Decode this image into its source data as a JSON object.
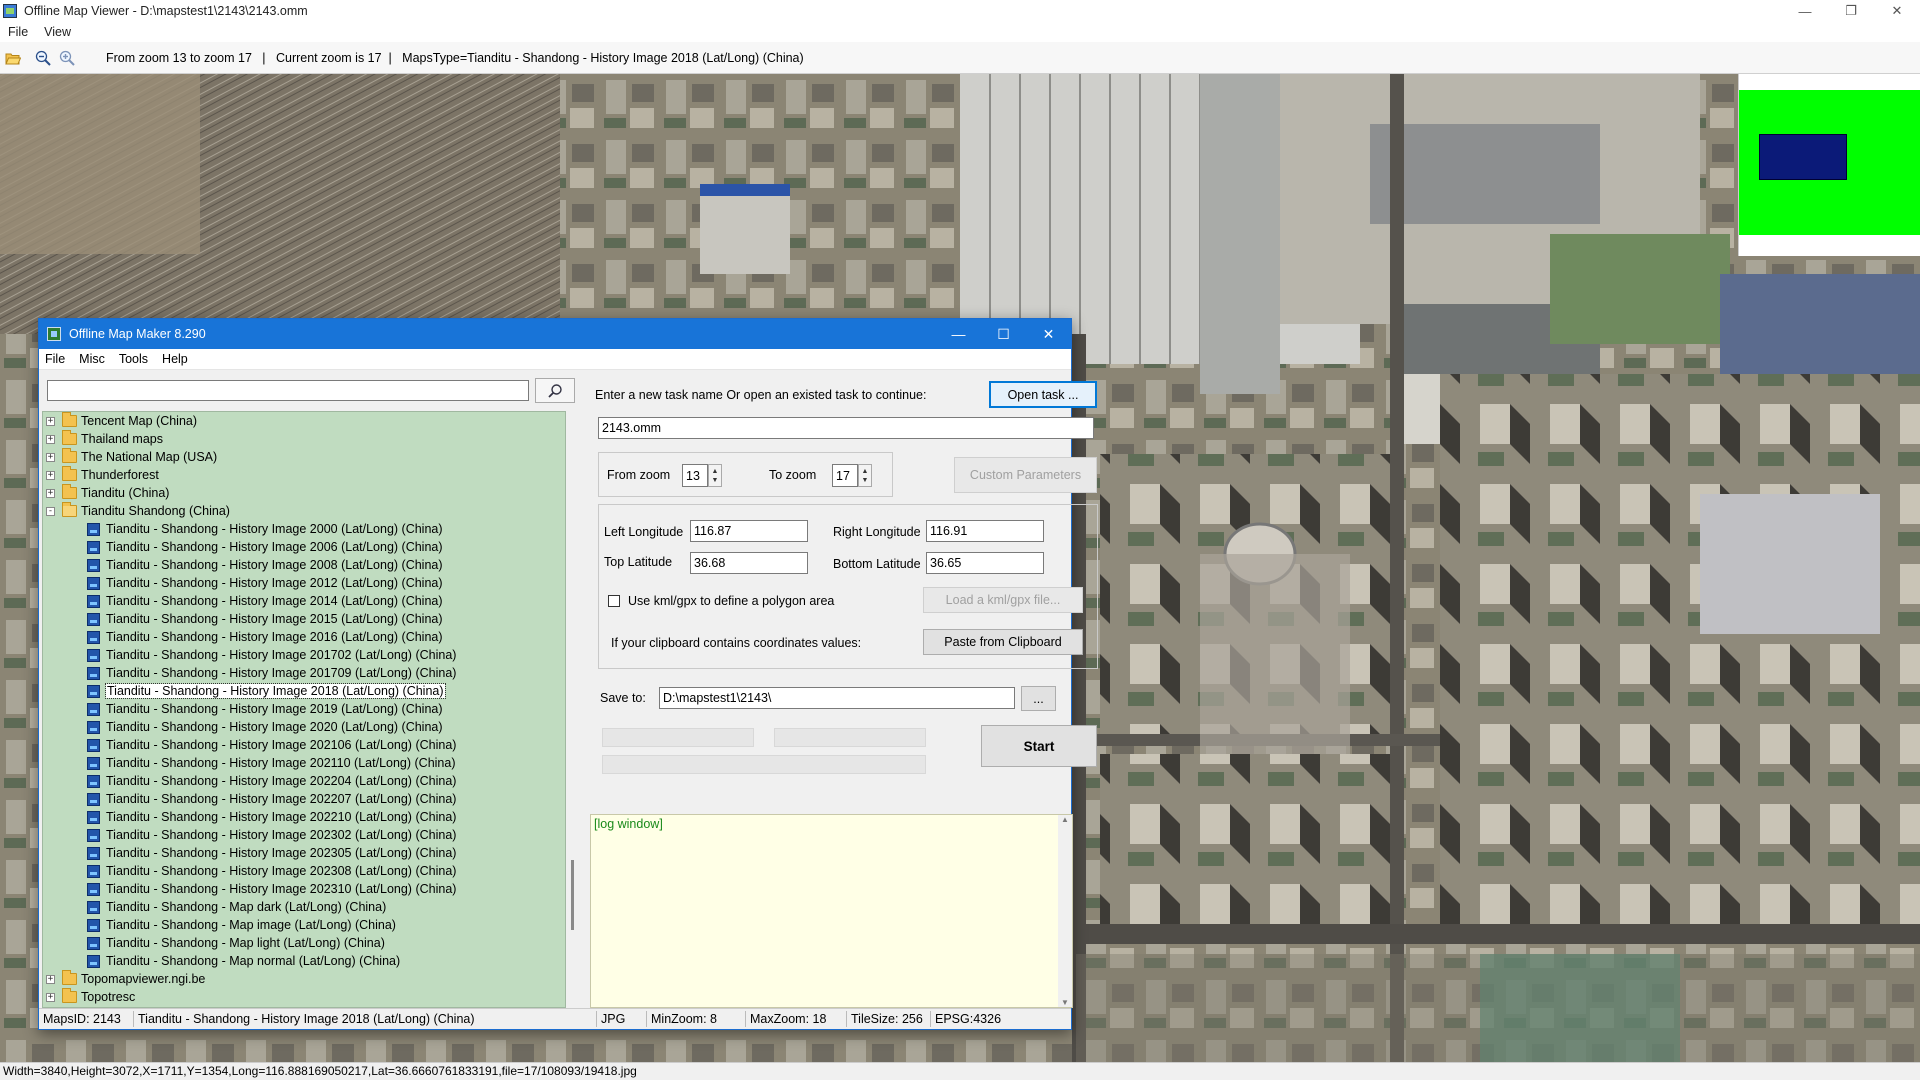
{
  "viewer": {
    "title": "Offline Map Viewer - D:\\mapstest1\\2143\\2143.omm",
    "menu": [
      "File",
      "View"
    ],
    "toolbar_info": "From zoom 13 to zoom 17   |   Current zoom is 17  |   MapsType=Tianditu - Shandong - History Image 2018 (Lat/Long) (China)",
    "status": "Width=3840,Height=3072,X=1711,Y=1354,Long=116.888169050217,Lat=36.6660761833191,file=17/108093/19418.jpg"
  },
  "dialog": {
    "title": "Offline Map Maker 8.290",
    "menu": [
      "File",
      "Misc",
      "Tools",
      "Help"
    ],
    "search": {
      "value": "",
      "placeholder": ""
    },
    "tree": {
      "folders_top": [
        "Tencent Map (China)",
        "Thailand maps",
        "The National Map (USA)",
        "Thunderforest",
        "Tianditu (China)"
      ],
      "open_folder": "Tianditu Shandong (China)",
      "leaves": [
        "Tianditu - Shandong - History Image 2000 (Lat/Long) (China)",
        "Tianditu - Shandong - History Image 2006 (Lat/Long) (China)",
        "Tianditu - Shandong - History Image 2008 (Lat/Long) (China)",
        "Tianditu - Shandong - History Image 2012 (Lat/Long) (China)",
        "Tianditu - Shandong - History Image 2014 (Lat/Long) (China)",
        "Tianditu - Shandong - History Image 2015 (Lat/Long) (China)",
        "Tianditu - Shandong - History Image 2016 (Lat/Long) (China)",
        "Tianditu - Shandong - History Image 201702 (Lat/Long) (China)",
        "Tianditu - Shandong - History Image 201709 (Lat/Long) (China)",
        "Tianditu - Shandong - History Image 2018 (Lat/Long) (China)",
        "Tianditu - Shandong - History Image 2019 (Lat/Long) (China)",
        "Tianditu - Shandong - History Image 2020 (Lat/Long) (China)",
        "Tianditu - Shandong - History Image 202106 (Lat/Long) (China)",
        "Tianditu - Shandong - History Image 202110 (Lat/Long) (China)",
        "Tianditu - Shandong - History Image 202204 (Lat/Long) (China)",
        "Tianditu - Shandong - History Image 202207 (Lat/Long) (China)",
        "Tianditu - Shandong - History Image 202210 (Lat/Long) (China)",
        "Tianditu - Shandong - History Image 202302 (Lat/Long) (China)",
        "Tianditu - Shandong - History Image 202305 (Lat/Long) (China)",
        "Tianditu - Shandong - History Image 202308 (Lat/Long) (China)",
        "Tianditu - Shandong - History Image 202310 (Lat/Long) (China)",
        "Tianditu - Shandong - Map dark (Lat/Long) (China)",
        "Tianditu - Shandong - Map image (Lat/Long) (China)",
        "Tianditu - Shandong - Map light (Lat/Long) (China)",
        "Tianditu - Shandong - Map normal (Lat/Long) (China)"
      ],
      "selected_index": 9,
      "folders_bottom": [
        "Topomapviewer.ngi.be",
        "Topotresc"
      ]
    },
    "task": {
      "prompt": "Enter a new task name Or open an existed task to continue:",
      "open_button": "Open task ...",
      "name": "2143.omm"
    },
    "zoom": {
      "from_label": "From zoom",
      "from_value": "13",
      "to_label": "To zoom",
      "to_value": "17",
      "custom_button": "Custom Parameters"
    },
    "coords": {
      "left_label": "Left Longitude",
      "left_value": "116.87",
      "right_label": "Right Longitude",
      "right_value": "116.91",
      "top_label": "Top Latitude",
      "top_value": "36.68",
      "bottom_label": "Bottom Latitude",
      "bottom_value": "36.65",
      "kml_label": "Use kml/gpx to define a polygon area",
      "kml_button": "Load a kml/gpx file...",
      "clipboard_label": "If your clipboard contains coordinates values:",
      "clipboard_button": "Paste from Clipboard"
    },
    "save": {
      "label": "Save to:",
      "path": "D:\\mapstest1\\2143\\",
      "browse_button": "..."
    },
    "start_button": "Start",
    "log_text": "[log window]",
    "status": {
      "maps_id": "MapsID: 2143",
      "map_name": "Tianditu - Shandong - History Image 2018 (Lat/Long) (China)",
      "format": "JPG",
      "min_zoom": "MinZoom: 8",
      "max_zoom": "MaxZoom: 18",
      "tile_size": "TileSize: 256",
      "epsg": "EPSG:4326"
    }
  },
  "colors": {
    "dialog_titlebar": "#1874d8",
    "tree_background": "#c0dcc0",
    "log_background": "#ffffe6",
    "log_text": "#1a8a1a",
    "minimap_green": "#00ff00",
    "minimap_blue": "#0b1a78"
  }
}
